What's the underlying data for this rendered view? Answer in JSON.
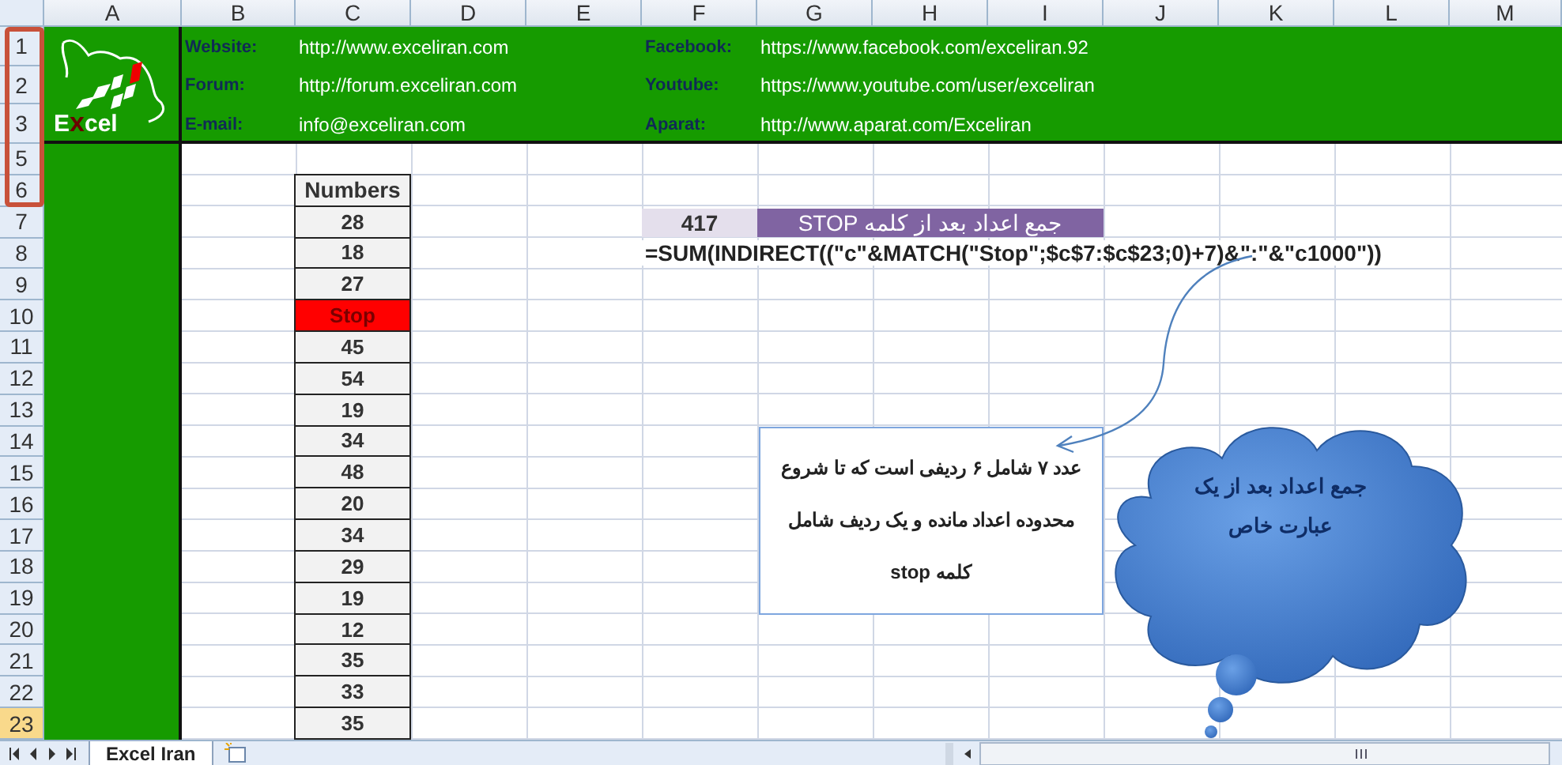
{
  "columns": [
    "A",
    "B",
    "C",
    "D",
    "E",
    "F",
    "G",
    "H",
    "I",
    "J",
    "K",
    "L",
    "M"
  ],
  "rows": [
    {
      "label": "1",
      "selected": false
    },
    {
      "label": "2",
      "selected": false
    },
    {
      "label": "3",
      "selected": false
    },
    {
      "label": "5",
      "selected": false
    },
    {
      "label": "6",
      "selected": false
    },
    {
      "label": "7",
      "selected": false
    },
    {
      "label": "8",
      "selected": false
    },
    {
      "label": "9",
      "selected": false
    },
    {
      "label": "10",
      "selected": false
    },
    {
      "label": "11",
      "selected": false
    },
    {
      "label": "12",
      "selected": false
    },
    {
      "label": "13",
      "selected": false
    },
    {
      "label": "14",
      "selected": false
    },
    {
      "label": "15",
      "selected": false
    },
    {
      "label": "16",
      "selected": false
    },
    {
      "label": "17",
      "selected": false
    },
    {
      "label": "18",
      "selected": false
    },
    {
      "label": "19",
      "selected": false
    },
    {
      "label": "20",
      "selected": false
    },
    {
      "label": "21",
      "selected": false
    },
    {
      "label": "22",
      "selected": false
    },
    {
      "label": "23",
      "selected": true
    }
  ],
  "banner": {
    "logo_text": "Excel",
    "left_links": [
      {
        "label": "Website:",
        "value": "http://www.exceliran.com"
      },
      {
        "label": "Forum:",
        "value": "http://forum.exceliran.com"
      },
      {
        "label": "E-mail:",
        "value": "info@exceliran.com"
      }
    ],
    "right_links": [
      {
        "label": "Facebook:",
        "value": "https://www.facebook.com/exceliran.92"
      },
      {
        "label": "Youtube:",
        "value": "https://www.youtube.com/user/exceliran"
      },
      {
        "label": "Aparat:",
        "value": "http://www.aparat.com/Exceliran"
      }
    ]
  },
  "numbers": {
    "header": "Numbers",
    "values": [
      {
        "value": "28",
        "highlighted": false
      },
      {
        "value": "18",
        "highlighted": false
      },
      {
        "value": "27",
        "highlighted": false
      },
      {
        "value": "Stop",
        "highlighted": true
      },
      {
        "value": "45",
        "highlighted": false
      },
      {
        "value": "54",
        "highlighted": false
      },
      {
        "value": "19",
        "highlighted": false
      },
      {
        "value": "34",
        "highlighted": false
      },
      {
        "value": "48",
        "highlighted": false
      },
      {
        "value": "20",
        "highlighted": false
      },
      {
        "value": "34",
        "highlighted": false
      },
      {
        "value": "29",
        "highlighted": false
      },
      {
        "value": "19",
        "highlighted": false
      },
      {
        "value": "12",
        "highlighted": false
      },
      {
        "value": "35",
        "highlighted": false
      },
      {
        "value": "33",
        "highlighted": false
      },
      {
        "value": "35",
        "highlighted": false
      }
    ]
  },
  "summary": {
    "result": "417",
    "title": "جمع اعداد بعد از کلمه STOP"
  },
  "formula": "=SUM(INDIRECT((\"c\"&MATCH(\"Stop\";$c$7:$c$23;0)+7)&\":\"&\"c1000\"))",
  "note": [
    "عدد ۷ شامل ۶ ردیفی است که تا شروع",
    "محدوده اعداد مانده و یک ردیف شامل",
    "کلمه stop"
  ],
  "cloud": [
    "جمع اعداد بعد از یک",
    "عبارت خاص"
  ],
  "sheet_tabs": [
    {
      "label": "Excel Iran",
      "selected": true
    }
  ]
}
